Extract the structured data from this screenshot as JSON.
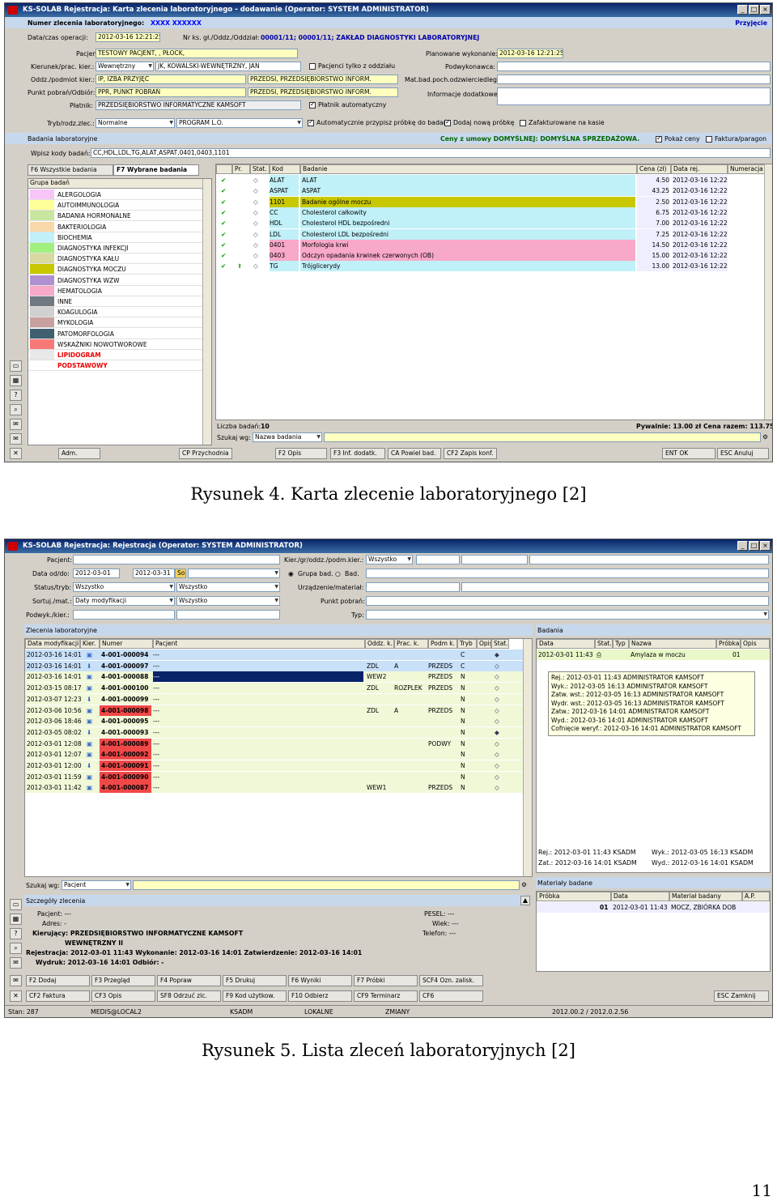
{
  "fig4": {
    "title": "KS-SOLAB Rejestracja:  Karta zlecenia laboratoryjnego - dodawanie (Operator: SYSTEM ADMINISTRATOR)",
    "order_label": "Numer zlecenia laboratoryjnego:",
    "order_value": "XXXX XXXXXX",
    "admission": "Przyjęcie",
    "date_label": "Data/czas operacji:",
    "date_value": "2012-03-16 12:21:25",
    "nrks_label": "Nr ks. gł./Oddz./Oddział:",
    "nrks_value": "00001/11; 00001/11; ZAKŁAD DIAGNOSTYKI LABORATORYJNEJ",
    "patient_label": "Pacjent:",
    "patient_value": "TESTOWY PACJENT, , PŁOCK,",
    "planned_label": "Planowane wykonanie:",
    "planned_value": "2012-03-16 12:21:25",
    "ref_label": "Kierunek/prac. kier.:",
    "ref_value": "Wewnętrzny",
    "ref_doc": "JK, KOWALSKI-WEWNĘTRZNY, JAN",
    "dept_only": "Pacjenci tylko z oddziału",
    "signer_label": "Podwykonawca:",
    "dept_label": "Oddz./podmiot kier.:",
    "dept_value": "IP, IZBA PRZYJĘĆ",
    "dept_value2": "PRZEDSI, PRZEDSIĘBIORSTWO INFORM.",
    "mat_label": "Mat.bad.poch.odzwierciedlego:",
    "point_label": "Punkt pobrań/Odbiór:",
    "point_value": "PPR, PUNKT POBRAŃ",
    "point_value2": "PRZEDSI, PRZEDSIĘBIORSTWO INFORM.",
    "info_label": "Informacje dodatkowe:",
    "payer_label": "Płatnik:",
    "payer_value": "PRZEDSIĘBIORSTWO INFORMATYCZNE KAMSOFT",
    "payer_auto": "Płatnik automatyczny",
    "mode_label": "Tryb/rodz.zlec.:",
    "mode_value": "Normalne",
    "mode_value2": "PROGRAM L.O.",
    "auto_sample": "Automatycznie przypisz próbkę do badań",
    "new_sample": "Dodaj nową próbkę",
    "stored": "Zafakturowane na kasie",
    "tests_header": "Badania laboratoryjne",
    "prices": "Ceny z umowy DOMYŚLNEJ: DOMYŚLNA SPRZEDAŻOWA.",
    "show_prices": "Pokaż ceny",
    "invoice": "Faktura/paragon",
    "codes_label": "Wpisz kody badań:",
    "codes_value": "CC,HDL,LDL,TG,ALAT,ASPAT,0401,0403,1101",
    "tab_all": "F6 Wszystkie badania",
    "tab_sel": "F7 Wybrane badania",
    "groups_header": "Grupa badań",
    "groups": [
      {
        "name": "ALERGOLOGIA",
        "color": "#f7c6f7"
      },
      {
        "name": "AUTOIMMUNOLOGIA",
        "color": "#ffff99"
      },
      {
        "name": "BADANIA HORMONALNE",
        "color": "#c8e6a0"
      },
      {
        "name": "BAKTERIOLOGIA",
        "color": "#f8d7a8"
      },
      {
        "name": "BIOCHEMIA",
        "color": "#c0f0f8"
      },
      {
        "name": "DIAGNOSTYKA INFEKCJI",
        "color": "#a0f080"
      },
      {
        "name": "DIAGNOSTYKA KAŁU",
        "color": "#d8d8a0"
      },
      {
        "name": "DIAGNOSTYKA MOCZU",
        "color": "#c8c800"
      },
      {
        "name": "DIAGNOSTYKA WZW",
        "color": "#b090d0"
      },
      {
        "name": "HEMATOLOGIA",
        "color": "#f8a8c8"
      },
      {
        "name": "INNE",
        "color": "#707880"
      },
      {
        "name": "KOAGULOGIA",
        "color": "#d0d0d0"
      },
      {
        "name": "MYKOLOGIA",
        "color": "#c8a0a0"
      },
      {
        "name": "PATOMORFOLOGIA",
        "color": "#406070"
      },
      {
        "name": "WSKAŹNIKI NOWOTWOROWE",
        "color": "#f87878"
      },
      {
        "name": "LIPIDOGRAM",
        "color": "#e8e8e8"
      },
      {
        "name": "PODSTAWOWY",
        "color": "#ffffff"
      }
    ],
    "cols": [
      "Pr.",
      "Stat.",
      "Kod",
      "Badanie",
      "Cena (zł)",
      "Data rej.",
      "Numeracja"
    ],
    "tests": [
      {
        "code": "ALAT",
        "name": "ALAT",
        "price": "4.50",
        "date": "2012-03-16 12:22",
        "color": "#c0f0f8"
      },
      {
        "code": "ASPAT",
        "name": "ASPAT",
        "price": "43.25",
        "date": "2012-03-16 12:22",
        "color": "#c0f0f8"
      },
      {
        "code": "1101",
        "name": "Badanie ogólne moczu",
        "price": "2.50",
        "date": "2012-03-16 12:22",
        "color": "#c8c800"
      },
      {
        "code": "CC",
        "name": "Cholesterol całkowity",
        "price": "6.75",
        "date": "2012-03-16 12:22",
        "color": "#c0f0f8"
      },
      {
        "code": "HDL",
        "name": "Cholesterol HDL bezpośredni",
        "price": "7.00",
        "date": "2012-03-16 12:22",
        "color": "#c0f0f8"
      },
      {
        "code": "LDL",
        "name": "Cholesterol LDL bezpośredni",
        "price": "7.25",
        "date": "2012-03-16 12:22",
        "color": "#c0f0f8"
      },
      {
        "code": "0401",
        "name": "Morfologia krwi",
        "price": "14.50",
        "date": "2012-03-16 12:22",
        "color": "#f8a8c8"
      },
      {
        "code": "0403",
        "name": "Odczyn opadania krwinek czerwonych (OB)",
        "price": "15.00",
        "date": "2012-03-16 12:22",
        "color": "#f8a8c8"
      },
      {
        "code": "TG",
        "name": "Trójglicerydy",
        "price": "13.00",
        "date": "2012-03-16 12:22",
        "color": "#c0f0f8"
      }
    ],
    "count_label": "Liczba badań:",
    "count_value": "10",
    "total": "Pywalnie: 13.00 zł Cena razem: 113.75 zł",
    "search_label": "Szukaj wg:",
    "search_value": "Nazwa badania",
    "buttons": [
      "Adm.",
      "CP Przychodnia",
      "F2 Opis",
      "F3 Inf. dodatk.",
      "CA Powiel bad.",
      "CF2 Zapis konf."
    ],
    "ok": "ENT OK",
    "cancel": "ESC Anuluj"
  },
  "caption4": "Rysunek 4. Karta zlecenie laboratoryjnego [2]",
  "fig5": {
    "title": "KS-SOLAB Rejestracja:  Rejestracja (Operator: SYSTEM ADMINISTRATOR)",
    "patient_label": "Pacjent:",
    "from_label": "Data od/do:",
    "from_value": "2012-03-01",
    "to_value": "2012-03-31",
    "so": "So",
    "kier_label": "Kier./gr/oddz./podm.kier.:",
    "kier_value": "Wszystko",
    "gb_label": "Grupa bad.",
    "bad_label": "Bad.",
    "status_label": "Status/tryb:",
    "status_value": "Wszystko",
    "status_value2": "Wszystko",
    "device_label": "Urządzenie/materiał:",
    "sort_label": "Sortuj./mat.:",
    "sort_value": "Daty modyfikacji",
    "sort_value2": "Wszystko",
    "point_label": "Punkt pobrań:",
    "podw_label": "Podwyk./kier.:",
    "typ_label": "Typ:",
    "orders_header": "Zlecenia laboratoryjne",
    "cols": [
      "Data modyfikacji",
      "Kier.",
      "Numer",
      "Pacjent",
      "Oddz. k.",
      "Prac. k.",
      "Podm k.",
      "Tryb",
      "Opis",
      "Stat."
    ],
    "orders": [
      {
        "date": "2012-03-16 14:01",
        "num": "4-001-000094",
        "pat": "---",
        "oddz": "",
        "prac": "",
        "podm": "",
        "tryb": "C",
        "sel": "light",
        "red": false
      },
      {
        "date": "2012-03-16 14:01",
        "num": "4-001-000097",
        "pat": "---",
        "oddz": "ZDL",
        "prac": "A",
        "podm": "PRZEDS",
        "tryb": "C",
        "sel": "light",
        "red": false
      },
      {
        "date": "2012-03-16 14:01",
        "num": "4-001-000088",
        "pat": "---",
        "oddz": "WEW2",
        "prac": "",
        "podm": "PRZEDS",
        "tryb": "N",
        "sel": "dark",
        "red": false
      },
      {
        "date": "2012-03-15 08:17",
        "num": "4-001-000100",
        "pat": "---",
        "oddz": "ZDL",
        "prac": "ROZPLEK",
        "podm": "PRZEDS",
        "tryb": "N",
        "sel": "",
        "red": false
      },
      {
        "date": "2012-03-07 12:23",
        "num": "4-001-000099",
        "pat": "---",
        "oddz": "",
        "prac": "",
        "podm": "",
        "tryb": "N",
        "sel": "",
        "red": false
      },
      {
        "date": "2012-03-06 10:56",
        "num": "4-001-000098",
        "pat": "---",
        "oddz": "ZDL",
        "prac": "A",
        "podm": "PRZEDS",
        "tryb": "N",
        "sel": "",
        "red": true
      },
      {
        "date": "2012-03-06 18:46",
        "num": "4-001-000095",
        "pat": "---",
        "oddz": "",
        "prac": "",
        "podm": "",
        "tryb": "N",
        "sel": "",
        "red": false
      },
      {
        "date": "2012-03-05 08:02",
        "num": "4-001-000093",
        "pat": "---",
        "oddz": "",
        "prac": "",
        "podm": "",
        "tryb": "N",
        "sel": "",
        "red": false
      },
      {
        "date": "2012-03-01 12:08",
        "num": "4-001-000089",
        "pat": "---",
        "oddz": "",
        "prac": "",
        "podm": "PODWY",
        "tryb": "N",
        "sel": "",
        "red": true
      },
      {
        "date": "2012-03-01 12:07",
        "num": "4-001-000092",
        "pat": "---",
        "oddz": "",
        "prac": "",
        "podm": "",
        "tryb": "N",
        "sel": "",
        "red": true
      },
      {
        "date": "2012-03-01 12:00",
        "num": "4-001-000091",
        "pat": "---",
        "oddz": "",
        "prac": "",
        "podm": "",
        "tryb": "N",
        "sel": "",
        "red": true
      },
      {
        "date": "2012-03-01 11:59",
        "num": "4-001-000090",
        "pat": "---",
        "oddz": "",
        "prac": "",
        "podm": "",
        "tryb": "N",
        "sel": "",
        "red": true
      },
      {
        "date": "2012-03-01 11:42",
        "num": "4-001-000087",
        "pat": "---",
        "oddz": "WEW1",
        "prac": "",
        "podm": "PRZEDS",
        "tryb": "N",
        "sel": "",
        "red": true
      }
    ],
    "search_label": "Szukaj wg:",
    "search_value": "Pacjent",
    "tests_header": "Badania",
    "tcols": [
      "Data",
      "Stat.",
      "Typ",
      "Nazwa",
      "Próbka",
      "Opis"
    ],
    "test_row": {
      "date": "2012-03-01 11:43",
      "name": "Amylaza w moczu",
      "sample": "01"
    },
    "tooltip": [
      "Rej.: 2012-03-01 11:43 ADMINISTRATOR KAMSOFT",
      "Wyk.: 2012-03-05 16:13 ADMINISTRATOR KAMSOFT",
      "Zatw. wst.: 2012-03-05 16:13 ADMINISTRATOR KAMSOFT",
      "Wydr. wst.: 2012-03-05 16:13 ADMINISTRATOR KAMSOFT",
      "Zatw.: 2012-03-16 14:01 ADMINISTRATOR KAMSOFT",
      "Wyd.: 2012-03-16 14:01 ADMINISTRATOR KAMSOFT",
      "Cofnięcie weryf.: 2012-03-16 14:01 ADMINISTRATOR KAMSOFT"
    ],
    "rej_line": "Rej.: 2012-03-01 11:43 KSADM",
    "wyk_line": "Wyk.: 2012-03-05 16:13 KSADM",
    "zat_line": "Zat.: 2012-03-16 14:01 KSADM",
    "wyd_line": "Wyd.: 2012-03-16 14:01 KSADM",
    "mat_header": "Materiały badane",
    "mcols": [
      "Próbka",
      "Data",
      "Materiał badany",
      "A.P."
    ],
    "mat_row": {
      "sample": "01",
      "date": "2012-03-01 11:43",
      "mat": "MOCZ, ZBIÓRKA DOB"
    },
    "details_header": "Szczegóły zlecenia",
    "d_patient": "Pacjent: ---",
    "d_address": "Adres: -",
    "d_kier": "Kierujący: PRZEDSIĘBIORSTWO INFORMATYCZNE KAMSOFT",
    "d_kier2": "WEWNĘTRZNY II",
    "d_rej": "Rejestracja: 2012-03-01 11:43  Wykonanie: 2012-03-16 14:01  Zatwierdzenie: 2012-03-16 14:01",
    "d_wyd": "Wydruk: 2012-03-16 14:01       Odbiór: -",
    "d_pesel": "PESEL: ---",
    "d_wiek": "Wiek: ---",
    "d_tel": "Telefon: ---",
    "btns1": [
      "F2 Dodaj",
      "F3 Przegląd",
      "F4 Popraw",
      "F5 Drukuj",
      "F6 Wyniki",
      "F7 Próbki",
      "SCF4 Ozn. zalisk."
    ],
    "btns2": [
      "CF2 Faktura",
      "CF3 Opis",
      "SF8 Odrzuć zlc.",
      "F9 Kod użytkow.",
      "F10 Odbierz",
      "CF9 Terminarz",
      "CF6"
    ],
    "close": "ESC Zamknij",
    "status": [
      "Stan: 287",
      "MEDIS@LOCAL2",
      "KSADM",
      "LOKALNE",
      "ZMIANY",
      "2012.00.2 / 2012.0.2.56"
    ]
  },
  "caption5": "Rysunek 5. Lista zleceń laboratoryjnych [2]",
  "page_number": "11"
}
